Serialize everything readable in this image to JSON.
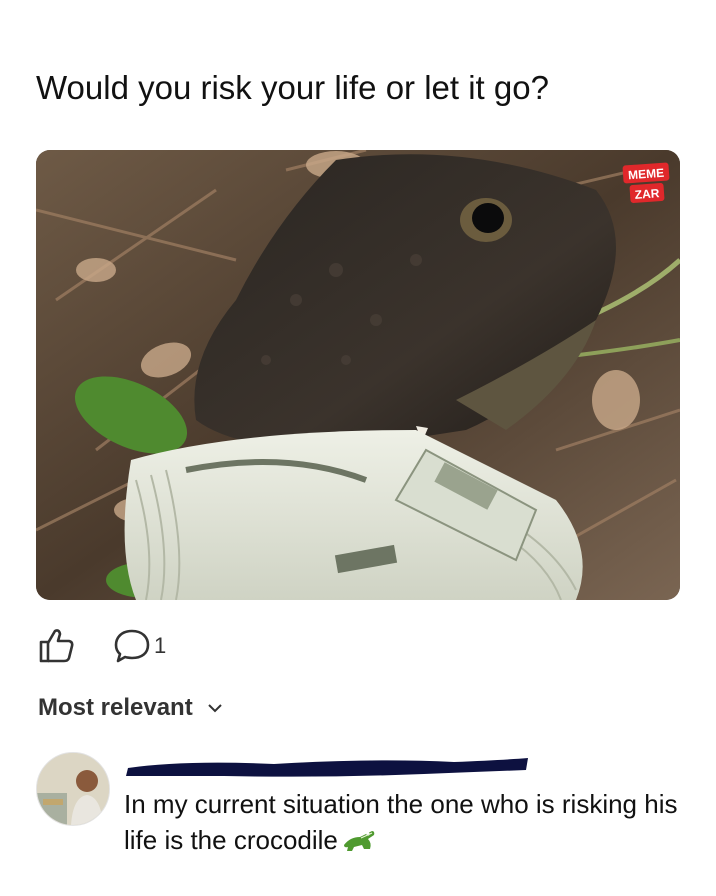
{
  "post": {
    "text": "Would you risk your life or let it go?",
    "image_watermark": {
      "line1": "MEME",
      "line2": "ZAR"
    }
  },
  "actions": {
    "like_icon": "thumbs-up-icon",
    "comment_icon": "comment-bubble-icon",
    "comment_count": "1"
  },
  "comments_section": {
    "sort_label": "Most relevant",
    "sort_icon": "chevron-down-icon"
  },
  "comment": {
    "author_redacted": true,
    "text": "In my current situation the one who is risking his life is the crocodile",
    "emoji": "crocodile-emoji"
  },
  "colors": {
    "text": "#111111",
    "watermark": "#e0282b",
    "redaction": "#0d1140"
  }
}
